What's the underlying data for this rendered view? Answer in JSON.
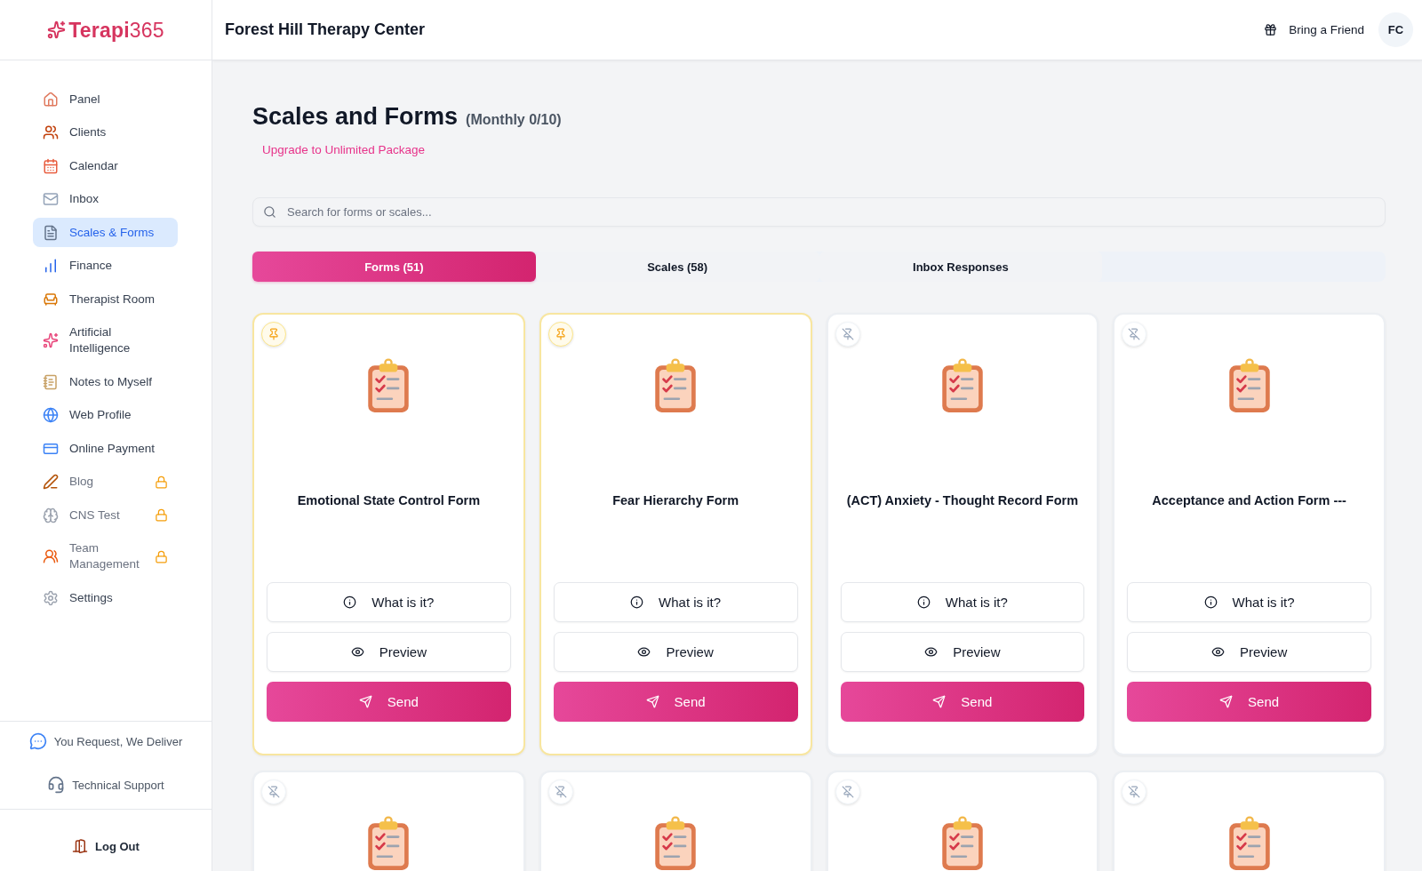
{
  "logo": {
    "text": "**Terapi**365"
  },
  "sidebar": {
    "items": [
      {
        "label": "Panel",
        "selected": false,
        "locked": false
      },
      {
        "label": "Clients",
        "selected": false,
        "locked": false
      },
      {
        "label": "Calendar",
        "selected": false,
        "locked": false
      },
      {
        "label": "Inbox",
        "selected": false,
        "locked": false
      },
      {
        "label": "Scales & Forms",
        "selected": true,
        "locked": false
      },
      {
        "label": "Finance",
        "selected": false,
        "locked": false
      },
      {
        "label": "Therapist Room",
        "selected": false,
        "locked": false
      },
      {
        "label": "Artificial Intelligence",
        "selected": false,
        "locked": false
      },
      {
        "label": "Notes to Myself",
        "selected": false,
        "locked": false
      },
      {
        "label": "Web Profile",
        "selected": false,
        "locked": false
      },
      {
        "label": "Online Payment",
        "selected": false,
        "locked": false
      },
      {
        "label": "Blog",
        "selected": false,
        "locked": true
      },
      {
        "label": "CNS Test",
        "selected": false,
        "locked": true
      },
      {
        "label": "Team Management",
        "selected": false,
        "locked": true
      },
      {
        "label": "Settings",
        "selected": false,
        "locked": false
      }
    ],
    "footer_links": [
      "You Request, We Deliver",
      "Technical Support"
    ],
    "logout": "Log Out"
  },
  "header": {
    "title": "Forest Hill Therapy Center",
    "invite_link": "Bring a Friend",
    "avatar_initials": "FC"
  },
  "page": {
    "title": "Scales and Forms",
    "quota": "(Monthly 0/10)",
    "upgrade_link": "Upgrade to Unlimited Package"
  },
  "search": {
    "placeholder": "Search for forms or scales..."
  },
  "tabs": [
    {
      "label": "Forms (51)",
      "selected": true
    },
    {
      "label": "Scales (58)",
      "selected": false
    },
    {
      "label": "Inbox Responses",
      "selected": false
    }
  ],
  "cards": [
    {
      "title": "Emotional State Control Form",
      "pinned": true,
      "buttons": [
        {
          "kind": "info",
          "label": "What is it?"
        },
        {
          "kind": "preview",
          "label": "Preview"
        },
        {
          "kind": "send",
          "label": "Send"
        }
      ]
    },
    {
      "title": "Fear Hierarchy Form",
      "pinned": true,
      "buttons": [
        {
          "kind": "info",
          "label": "What is it?"
        },
        {
          "kind": "preview",
          "label": "Preview"
        },
        {
          "kind": "send",
          "label": "Send"
        }
      ]
    },
    {
      "title": "(ACT) Anxiety - Thought Record Form",
      "pinned": false,
      "buttons": [
        {
          "kind": "info",
          "label": "What is it?"
        },
        {
          "kind": "preview",
          "label": "Preview"
        },
        {
          "kind": "send",
          "label": "Send"
        }
      ]
    },
    {
      "title": "Acceptance and Action Form ---",
      "pinned": false,
      "buttons": [
        {
          "kind": "info",
          "label": "What is it?"
        },
        {
          "kind": "preview",
          "label": "Preview"
        },
        {
          "kind": "send",
          "label": "Send"
        }
      ]
    },
    {
      "pinned": false
    },
    {
      "pinned": false
    },
    {
      "pinned": false
    },
    {
      "pinned": false
    }
  ]
}
